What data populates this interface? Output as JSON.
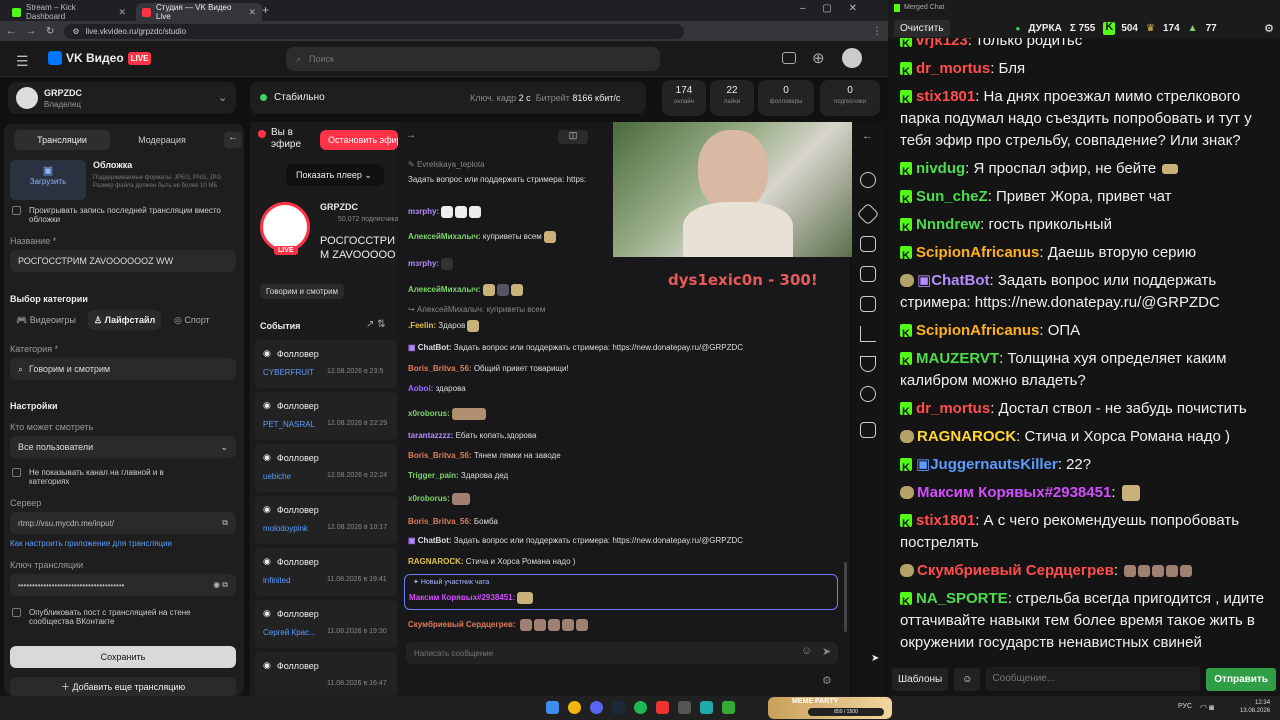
{
  "tabs": [
    {
      "label": "Stream – Kick Dashboard",
      "color": "#53fc18"
    },
    {
      "label": "Студия — VK Видео Live",
      "color": "#ff3347"
    }
  ],
  "url": "live.vkvideo.ru/grpzdc/studio",
  "brand": {
    "name": "VK Видео",
    "badge": "LIVE"
  },
  "search_placeholder": "Поиск",
  "channel": {
    "name": "GRPZDC",
    "role": "Владелец"
  },
  "status": {
    "label": "Стабильно",
    "keyframe_label": "Ключ. кадр",
    "keyframe": "2 с",
    "bitrate_label": "Битрейт",
    "bitrate": "8166 кбит/с"
  },
  "stats": [
    {
      "v": "174",
      "l": "онлайн"
    },
    {
      "v": "22",
      "l": "лайки"
    },
    {
      "v": "0",
      "l": "фолловеры"
    },
    {
      "v": "0",
      "l": "подписчики"
    }
  ],
  "left": {
    "tabs": [
      "Трансляции",
      "Модерация"
    ],
    "cover_title": "Обложка",
    "cover_desc": "Поддерживаемые форматы: JPEG, PNG, JPG Размер файла должен быть не более 10 МБ",
    "upload": "Загрузить",
    "replay": "Проигрывать запись последней трансляции вместо обложки",
    "name_label": "Название *",
    "name_value": "РОСГОССТРИМ ZAVOOOOOOZ WW",
    "cat_title": "Выбор категории",
    "cats": [
      "Видеоигры",
      "Лайфстайл",
      "Спорт"
    ],
    "category_label": "Категория *",
    "category_value": "Говорим и смотрим",
    "settings": "Настройки",
    "who_label": "Кто может смотреть",
    "who_value": "Все пользователи",
    "hide": "Не показывать канал на главной и в категориях",
    "server_label": "Сервер",
    "server_value": "rtmp://vsu.mycdn.me/input/",
    "howto": "Как настроить приложение для трансляции",
    "key_label": "Ключ трансляции",
    "key_value": "••••••••••••••••••••••••••••••••••••••",
    "publish": "Опубликовать пост с трансляцией на стене сообщества ВКонтакте",
    "save": "Сохранить",
    "add": "Добавить еще трансляцию"
  },
  "center": {
    "onair": "Вы в эфире",
    "stop": "Остановить эфир",
    "player": "Показать плеер",
    "streamer": "GRPZDC",
    "subs": "50,072 подписчика",
    "title": "РОСГОССТРИМ ZAVOOOOOOZ WW",
    "tag": "Говорим и смотрим",
    "live": "LIVE",
    "events_title": "События",
    "events": [
      {
        "t": "Фолловер",
        "u": "CYBERFRUIT",
        "d": "12.08.2026 в 23:5"
      },
      {
        "t": "Фолловер",
        "u": "PET_NASRAL",
        "d": "12.08.2026 в 22:29"
      },
      {
        "t": "Фолловер",
        "u": "uebiche",
        "d": "12.08.2026 в 22:24"
      },
      {
        "t": "Фолловер",
        "u": "molodoypink",
        "d": "12.08.2026 в 10:17"
      },
      {
        "t": "Фолловер",
        "u": "infinited",
        "d": "11.08.2026 в 19:41"
      },
      {
        "t": "Фолловер",
        "u": "Сергей Крас...",
        "d": "11.08.2026 в 19:30"
      },
      {
        "t": "Фолловер",
        "u": "",
        "d": "11.08.2026 в 16:47"
      }
    ]
  },
  "vkchat": [
    {
      "n": "Evrelskaya_teplota",
      "m": "",
      "c": "#888"
    },
    {
      "n": "",
      "m": "Задать вопрос или поддержать стримера: https:",
      "c": "#ddd"
    },
    {
      "n": "mзrphy:",
      "m": "",
      "c": "#b48cff"
    },
    {
      "n": "АлексейМихалыч:",
      "m": "куприветы всем",
      "c": "#7fd36b"
    },
    {
      "n": "mзrphy:",
      "m": "",
      "c": "#b48cff"
    },
    {
      "n": "АлексейМихалыч:",
      "m": "",
      "c": "#7fd36b"
    },
    {
      "n": "АлексейМихалыч:",
      "m": "куприветы всем",
      "c": "#888"
    },
    {
      "n": ".Feelin:",
      "m": "Здаров",
      "c": "#e0c14a"
    },
    {
      "n": "ChatBot:",
      "m": "Задать вопрос или поддержать стримера: https://new.donatepay.ru/@GRPZDC",
      "c": "#eee"
    },
    {
      "n": "Boris_Britva_56:",
      "m": "Общий привет товарищи!",
      "c": "#e07b55"
    },
    {
      "n": "Aoboi:",
      "m": "здарова",
      "c": "#9b6bff"
    },
    {
      "n": "x0roborus:",
      "m": "",
      "c": "#7fd36b"
    },
    {
      "n": "tarantazzzz:",
      "m": "Ебать копать,здорова",
      "c": "#b48cff"
    },
    {
      "n": "Boris_Britva_56:",
      "m": "Тянем лямки на заводе",
      "c": "#e07b55"
    },
    {
      "n": "Trigger_pain:",
      "m": "Здарова дед",
      "c": "#7fd36b"
    },
    {
      "n": "x0roborus:",
      "m": "",
      "c": "#7fd36b"
    },
    {
      "n": "Boris_Britva_56:",
      "m": "Бомба",
      "c": "#e07b55"
    },
    {
      "n": "ChatBot:",
      "m": "Задать вопрос или поддержать стримера: https://new.donatepay.ru/@GRPZDC",
      "c": "#eee"
    },
    {
      "n": "RAGNAROCK:",
      "m": "Стича и Хорса Романа надо )",
      "c": "#e0c14a"
    }
  ],
  "newmember": {
    "label": "Новый участник чата",
    "n": "Максим Корявых#2938451:"
  },
  "lastmsg": {
    "n": "Скумбриевый Сердцегрев:"
  },
  "vkinput": "Написать сообщение",
  "overlay_text": "dys1exic0n - 300!",
  "mc": {
    "title": "Merged Chat",
    "clear": "Очистить",
    "game": "ДУРКА",
    "sigma": "Σ 755",
    "kick": "504",
    "vk": "174",
    "tw": "77",
    "msgs": [
      {
        "n": "vrjk123",
        "m": ": только родитьс",
        "c": "#ff4d4d",
        "i": "k"
      },
      {
        "n": "dr_mortus",
        "m": ": Бля",
        "c": "#ff4d4d",
        "i": "k"
      },
      {
        "n": "stix1801",
        "m": ": На днях проезжал мимо стрелкового парка подумал надо съездить попробовать и тут у тебя эфир про стрельбу, совпадение? Или знак?",
        "c": "#ff4d4d",
        "i": "k"
      },
      {
        "n": "nivdug",
        "m": ": Я проспал эфир, не бейте",
        "c": "#4ddc4d",
        "i": "k"
      },
      {
        "n": "Sun_cheZ",
        "m": ": Привет Жора, привет чат",
        "c": "#4ddc4d",
        "i": "k"
      },
      {
        "n": "Nnndrew",
        "m": ": гость прикольный",
        "c": "#4ddc4d",
        "i": "k"
      },
      {
        "n": "ScipionAfricanus",
        "m": ": Даешь вторую серию",
        "c": "#ffb020",
        "i": "k"
      },
      {
        "n": "ChatBot",
        "m": ": Задать вопрос или поддержать стримера: https://new.donatepay.ru/@GRPZDC",
        "c": "#b48cff",
        "i": "b"
      },
      {
        "n": "ScipionAfricanus",
        "m": ": ОПА",
        "c": "#ffb020",
        "i": "k"
      },
      {
        "n": "MAUZERVT",
        "m": ": Толщина хуя определяет каким калибром можно владеть?",
        "c": "#4ddc4d",
        "i": "k"
      },
      {
        "n": "dr_mortus",
        "m": ": Достал ствол - не забудь почистить",
        "c": "#ff4d4d",
        "i": "k"
      },
      {
        "n": "RAGNAROCK",
        "m": ": Стича и Хорса Романа надо )",
        "c": "#ffd633",
        "i": "b"
      },
      {
        "n": "JuggernautsKiller",
        "m": ": 22?",
        "c": "#5a9cff",
        "i": "k"
      },
      {
        "n": "Максим Корявых#2938451",
        "m": ":",
        "c": "#d34dff",
        "i": "b"
      },
      {
        "n": "stix1801",
        "m": ": А с чего рекомендуешь попробовать пострелять",
        "c": "#ff4d4d",
        "i": "k"
      },
      {
        "n": "Скумбриевый Сердцегрев",
        "m": ":",
        "c": "#ff4d4d",
        "i": "b"
      },
      {
        "n": "NA_SPORTE",
        "m": ": стрельба всегда пригодится , идите оттачивайте навыки тем более время такое жить в окружении государств ненавистных свиней",
        "c": "#4ddc4d",
        "i": "k"
      }
    ],
    "templates": "Шаблоны",
    "placeholder": "Сообщение...",
    "send": "Отправить"
  },
  "taskbar": {
    "lang": "РУС",
    "time": "12:34",
    "date": "13.08.2026",
    "meme": "MEME PARTY",
    "meme_count": "850 / 1500"
  }
}
